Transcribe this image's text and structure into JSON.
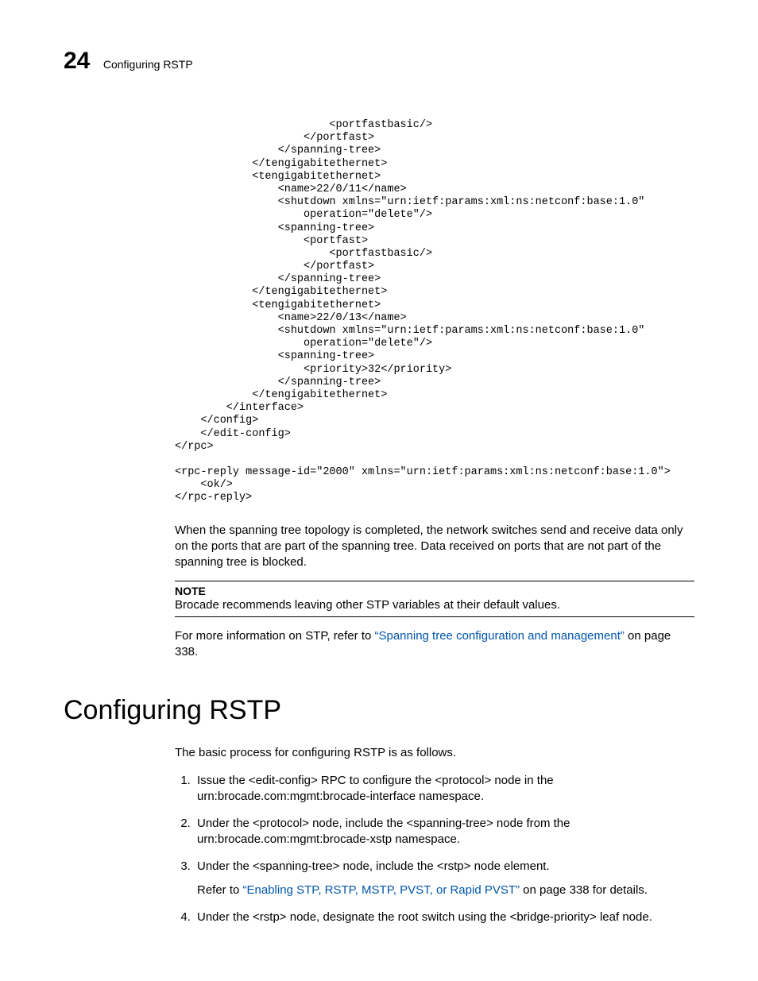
{
  "header": {
    "chapter_number": "24",
    "running_title": "Configuring RSTP"
  },
  "code": "                        <portfastbasic/>\n                    </portfast>\n                </spanning-tree>\n            </tengigabitethernet>\n            <tengigabitethernet>\n                <name>22/0/11</name>\n                <shutdown xmlns=\"urn:ietf:params:xml:ns:netconf:base:1.0\"\n                    operation=\"delete\"/>\n                <spanning-tree>\n                    <portfast>\n                        <portfastbasic/>\n                    </portfast>\n                </spanning-tree>\n            </tengigabitethernet>\n            <tengigabitethernet>\n                <name>22/0/13</name>\n                <shutdown xmlns=\"urn:ietf:params:xml:ns:netconf:base:1.0\"\n                    operation=\"delete\"/>\n                <spanning-tree>\n                    <priority>32</priority>\n                </spanning-tree>\n            </tengigabitethernet>\n        </interface>\n    </config>\n    </edit-config>\n</rpc>\n\n<rpc-reply message-id=\"2000\" xmlns=\"urn:ietf:params:xml:ns:netconf:base:1.0\">\n    <ok/>\n</rpc-reply>",
  "para1": "When the spanning tree topology is completed, the network switches send and receive data only on the ports that are part of the spanning tree. Data received on ports that are not part of the spanning tree is blocked.",
  "note": {
    "label": "NOTE",
    "text": "Brocade recommends leaving other STP variables at their default values."
  },
  "para2_a": "For more information on STP, refer to ",
  "para2_link": "“Spanning tree configuration and management”",
  "para2_b": " on page 338.",
  "h1": "Configuring RSTP",
  "intro": "The basic process for configuring RSTP is as follows.",
  "steps": [
    {
      "text": "Issue the <edit-config> RPC to configure the <protocol> node in the urn:brocade.com:mgmt:brocade-interface namespace."
    },
    {
      "text": "Under the <protocol> node, include the <spanning-tree> node from the urn:brocade.com:mgmt:brocade-xstp namespace."
    },
    {
      "text": "Under the <spanning-tree> node, include the <rstp> node element.",
      "sub_a": "Refer to ",
      "sub_link": "“Enabling STP, RSTP, MSTP, PVST, or Rapid PVST”",
      "sub_b": " on page 338 for details."
    },
    {
      "text": "Under the <rstp> node, designate the root switch using the <bridge-priority> leaf node."
    }
  ]
}
